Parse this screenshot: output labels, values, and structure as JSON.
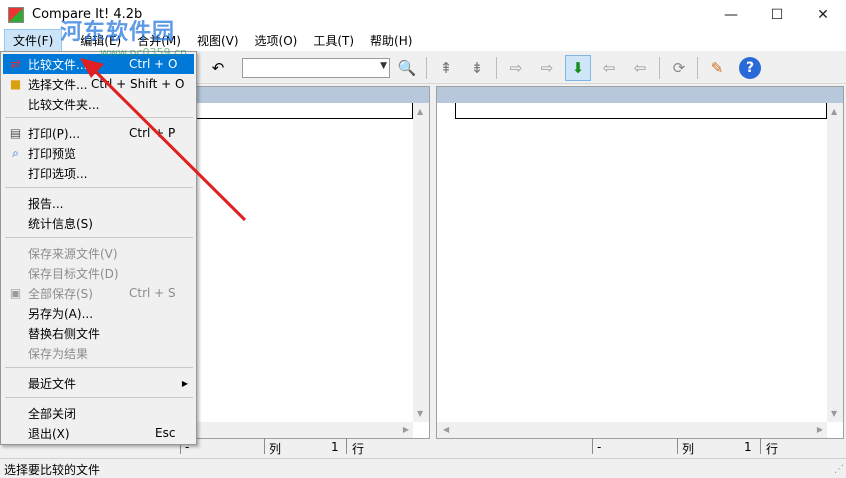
{
  "window": {
    "title": "Compare It! 4.2b",
    "minimize": "—",
    "maximize": "☐",
    "close": "✕"
  },
  "watermark": {
    "text": "河东软件园",
    "url": "www.pc0359.cn"
  },
  "menubar": {
    "items": [
      {
        "label": "文件(F)",
        "active": true
      },
      {
        "label": "编辑(E)"
      },
      {
        "label": "合并(M)"
      },
      {
        "label": "视图(V)"
      },
      {
        "label": "选项(O)"
      },
      {
        "label": "工具(T)"
      },
      {
        "label": "帮助(H)"
      }
    ]
  },
  "toolbar": {
    "search_value": "",
    "icons": [
      "undo-icon",
      "search-icon",
      "upload-icon",
      "download-icon",
      "copy-right-icon",
      "copy-right-alt-icon",
      "merge-down-icon",
      "copy-left-icon",
      "copy-left-alt-icon",
      "refresh-icon",
      "tools-icon",
      "help-icon"
    ]
  },
  "file_menu": {
    "items": [
      {
        "label": "比较文件...",
        "shortcut": "Ctrl + O",
        "icon": "compare-icon",
        "highlighted": true
      },
      {
        "label": "选择文件...",
        "shortcut": "Ctrl + Shift + O",
        "icon": "folder-icon"
      },
      {
        "label": "比较文件夹...",
        "shortcut": ""
      },
      {
        "label": "打印(P)...",
        "shortcut": "Ctrl + P",
        "icon": "print-icon"
      },
      {
        "label": "打印预览",
        "shortcut": "",
        "icon": "preview-icon"
      },
      {
        "label": "打印选项...",
        "shortcut": ""
      },
      {
        "label": "报告...",
        "shortcut": ""
      },
      {
        "label": "统计信息(S)",
        "shortcut": ""
      },
      {
        "label": "保存来源文件(V)",
        "shortcut": "",
        "disabled": true
      },
      {
        "label": "保存目标文件(D)",
        "shortcut": "",
        "disabled": true
      },
      {
        "label": "全部保存(S)",
        "shortcut": "Ctrl + S",
        "disabled": true,
        "icon": "save-icon"
      },
      {
        "label": "另存为(A)...",
        "shortcut": ""
      },
      {
        "label": "替换右侧文件",
        "shortcut": ""
      },
      {
        "label": "保存为结果",
        "shortcut": "",
        "disabled": true
      },
      {
        "label": "最近文件",
        "shortcut": "",
        "submenu": true
      },
      {
        "label": "全部关闭",
        "shortcut": ""
      },
      {
        "label": "退出(X)",
        "shortcut": "Esc"
      }
    ]
  },
  "pane_status": {
    "left": {
      "dash": "-",
      "col_label": "列",
      "col_value": "1",
      "row_label": "行"
    },
    "right": {
      "dash": "-",
      "col_label": "列",
      "col_value": "1",
      "row_label": "行"
    }
  },
  "statusbar": {
    "text": "选择要比较的文件"
  },
  "colors": {
    "highlight": "#0078d7",
    "pane_header": "#b8c8dc",
    "annotation": "#e02020"
  }
}
